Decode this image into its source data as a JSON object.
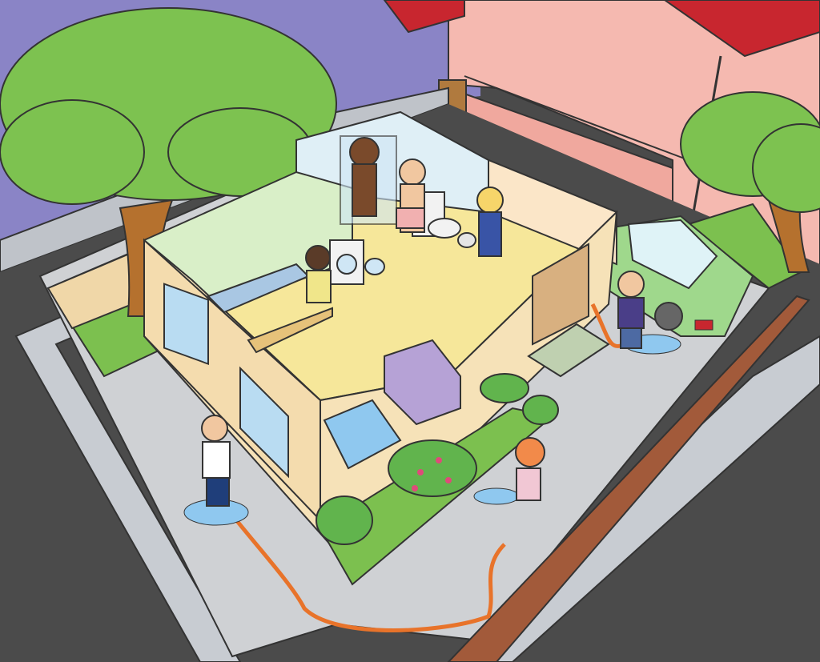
{
  "scene": {
    "title": "",
    "colors": {
      "sky": "#8a84c6",
      "street": "#4b4b4b",
      "sidewalk": "#c8ccd2",
      "yard_floor": "#cfd1d4",
      "wall_exterior": "#f6e2b8",
      "wall_kitchen": "#d9efc8",
      "floor_tile": "#f6e79a",
      "bath_wall": "#dfeff6",
      "neighbor_house": "#f5b9b0",
      "roof_tile": "#c8262f",
      "grass": "#7cc04f",
      "tree_foliage": "#7dc250",
      "trunk": "#b5712e",
      "car": "#9fd88c",
      "hose": "#e8732a",
      "water": "#8fc8ef",
      "fence": "#a25a3a"
    },
    "people": [
      {
        "role": "person-showering"
      },
      {
        "role": "person-brushing-teeth"
      },
      {
        "role": "girl-at-toilet"
      },
      {
        "role": "girl-washing-dishes"
      },
      {
        "role": "man-hosing-yard"
      },
      {
        "role": "girl-watering-garden"
      },
      {
        "role": "man-washing-car"
      }
    ],
    "objects": [
      "tree-left",
      "tree-right",
      "neighbor-house",
      "house-cutaway",
      "kitchen-sink",
      "washing-machine",
      "laundry-basket",
      "shower",
      "bathroom-sink",
      "toilet",
      "bucket",
      "sofa",
      "door",
      "doormat",
      "window-skylight",
      "car",
      "garden-hose",
      "flower-bed",
      "fence"
    ]
  }
}
